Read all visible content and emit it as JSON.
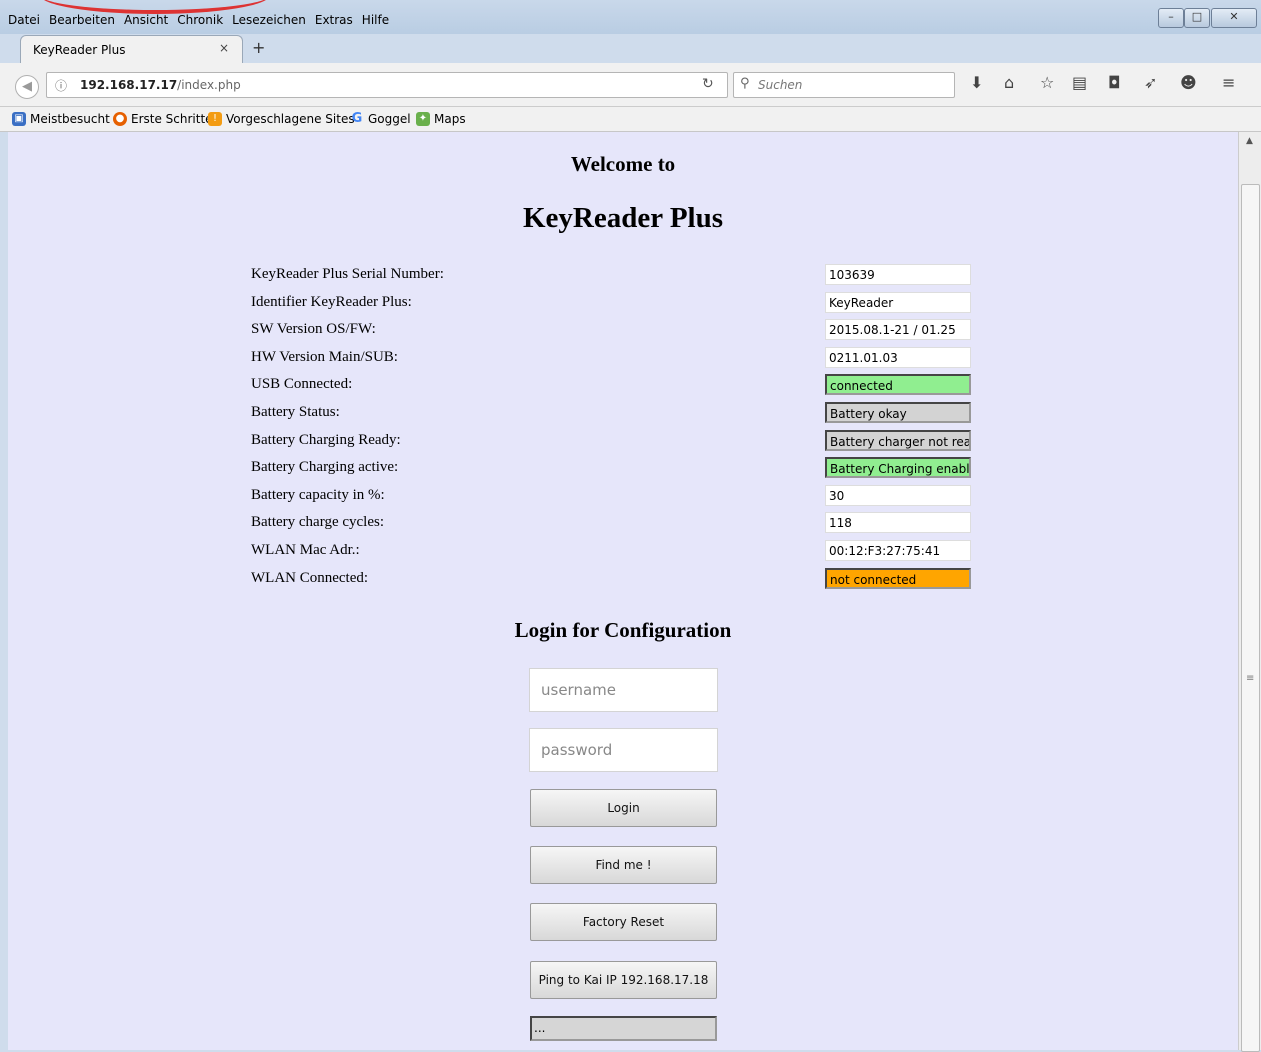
{
  "menu": [
    "Datei",
    "Bearbeiten",
    "Ansicht",
    "Chronik",
    "Lesezeichen",
    "Extras",
    "Hilfe"
  ],
  "window_controls": {
    "minimize": "–",
    "maximize": "□",
    "close": "✕"
  },
  "tab": {
    "title": "KeyReader Plus",
    "close": "×",
    "new": "+"
  },
  "nav": {
    "url_host": "192.168.17.17",
    "url_path": "/index.php",
    "search_placeholder": "Suchen"
  },
  "bookmarks": [
    "Meistbesucht",
    "Erste Schritte",
    "Vorgeschlagene Sites",
    "Goggel",
    "Maps"
  ],
  "page": {
    "welcome": "Welcome to",
    "product": "KeyReader Plus",
    "info": [
      {
        "label": "KeyReader Plus Serial Number:",
        "value": "103639",
        "color": "#ffffff"
      },
      {
        "label": "Identifier KeyReader Plus:",
        "value": "KeyReader",
        "color": "#ffffff"
      },
      {
        "label": "SW Version OS/FW:",
        "value": " 2015.08.1-21 / 01.25",
        "color": "#ffffff"
      },
      {
        "label": "HW Version Main/SUB:",
        "value": "0211.01.03",
        "color": "#ffffff"
      },
      {
        "label": "USB Connected:",
        "value": "connected",
        "color": "#90ee90"
      },
      {
        "label": "Battery Status:",
        "value": "Battery okay",
        "color": "#d3d3d3"
      },
      {
        "label": "Battery Charging Ready:",
        "value": "Battery charger not ready",
        "color": "#d3d3d3"
      },
      {
        "label": "Battery Charging active:",
        "value": "Battery Charging enabled",
        "color": "#90ee90"
      },
      {
        "label": "Battery capacity in %:",
        "value": " 30",
        "color": "#ffffff"
      },
      {
        "label": "Battery charge cycles:",
        "value": "118",
        "color": "#ffffff"
      },
      {
        "label": "WLAN Mac Adr.:",
        "value": "00:12:F3:27:75:41",
        "color": "#ffffff"
      },
      {
        "label": "WLAN Connected:",
        "value": "not connected",
        "color": "#ffa500"
      }
    ],
    "login_title": "Login for Configuration",
    "username_placeholder": "username",
    "password_placeholder": "password",
    "buttons": {
      "login": "Login",
      "find_me": "Find me !",
      "factory_reset": "Factory Reset",
      "ping": "Ping to Kai IP 192.168.17.18"
    },
    "ping_result": "..."
  }
}
